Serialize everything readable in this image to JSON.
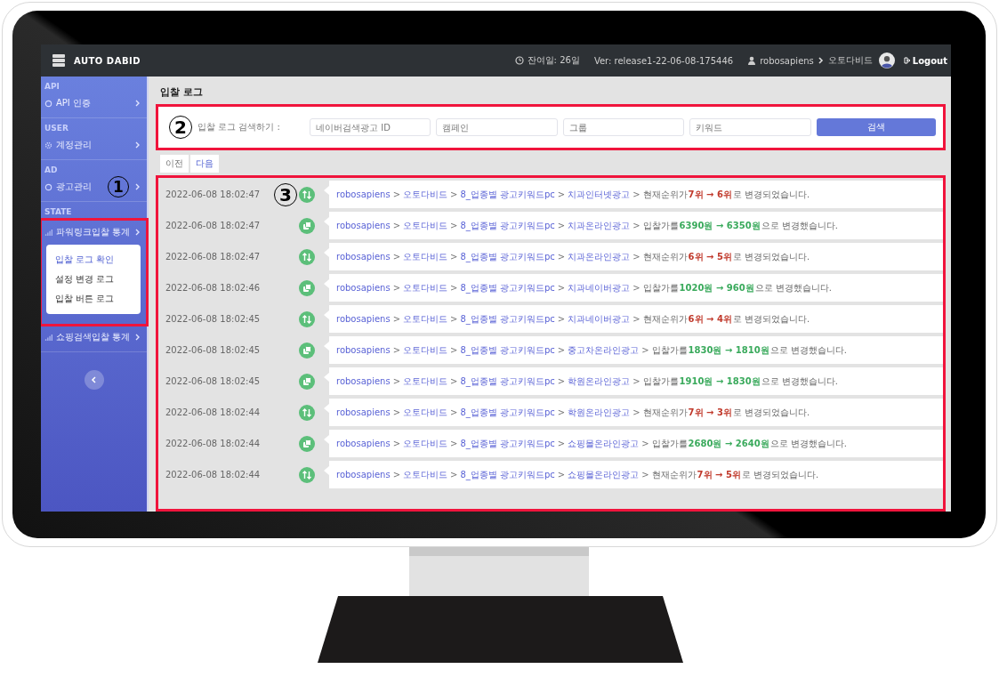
{
  "topbar": {
    "brand": "AUTO DABID",
    "remaining": "잔여일: 26일",
    "version": "Ver: release1-22-06-08-175446",
    "user": "robosapiens",
    "account": "오토다비드",
    "logout": "Logout"
  },
  "sidebar": {
    "sections": [
      {
        "heading": "API",
        "items": [
          {
            "label": "API 인증",
            "kind": "link",
            "expanded": false
          }
        ]
      },
      {
        "heading": "USER",
        "items": [
          {
            "label": "계정관리",
            "kind": "gear",
            "expanded": false
          }
        ]
      },
      {
        "heading": "AD",
        "items": [
          {
            "label": "광고관리",
            "kind": "link",
            "expanded": false
          }
        ]
      },
      {
        "heading": "STATE",
        "items": [
          {
            "label": "파워링크입찰 통계",
            "kind": "chart",
            "expanded": true,
            "children": [
              {
                "label": "입찰 로그 확인",
                "selected": true
              },
              {
                "label": "설정 변경 로그",
                "selected": false
              },
              {
                "label": "입찰 버튼 로그",
                "selected": false
              }
            ]
          },
          {
            "label": "쇼핑검색입찰 통계",
            "kind": "chart",
            "expanded": false
          }
        ]
      }
    ]
  },
  "page_title": "입찰 로그",
  "search": {
    "label": "입찰 로그 검색하기 :",
    "fields": [
      {
        "placeholder": "네이버검색광고 ID"
      },
      {
        "placeholder": "캠페인"
      },
      {
        "placeholder": "그룹"
      },
      {
        "placeholder": "키워드"
      }
    ],
    "button": "검색"
  },
  "pager": [
    {
      "label": "이전",
      "selected": false
    },
    {
      "label": "다음",
      "selected": true
    }
  ],
  "callouts": [
    "1",
    "2",
    "3"
  ],
  "logs": [
    {
      "time": "2022-06-08 18:02:47",
      "kind": "rank",
      "path": [
        "robosapiens",
        ">",
        "오토다비드",
        ">",
        "8_업종별 광고키워드pc",
        ">",
        "치과인터넷광고",
        ">"
      ],
      "lead": "현재순위가",
      "from": "7위",
      "arrow": "→",
      "to": "6위",
      "tail": "로 변경되었습니다."
    },
    {
      "time": "2022-06-08 18:02:47",
      "kind": "bid",
      "path": [
        "robosapiens",
        ">",
        "오토다비드",
        ">",
        "8_업종별 광고키워드pc",
        ">",
        "치과온라인광고",
        ">"
      ],
      "lead": "입찰가를",
      "from": "6390원",
      "arrow": "→",
      "to": "6350원",
      "tail": "으로 변경했습니다."
    },
    {
      "time": "2022-06-08 18:02:47",
      "kind": "rank",
      "path": [
        "robosapiens",
        ">",
        "오토다비드",
        ">",
        "8_업종별 광고키워드pc",
        ">",
        "치과온라인광고",
        ">"
      ],
      "lead": "현재순위가",
      "from": "6위",
      "arrow": "→",
      "to": "5위",
      "tail": "로 변경되었습니다."
    },
    {
      "time": "2022-06-08 18:02:46",
      "kind": "bid",
      "path": [
        "robosapiens",
        ">",
        "오토다비드",
        ">",
        "8_업종별 광고키워드pc",
        ">",
        "치과네이버광고",
        ">"
      ],
      "lead": "입찰가를",
      "from": "1020원",
      "arrow": "→",
      "to": "960원",
      "tail": "으로 변경했습니다."
    },
    {
      "time": "2022-06-08 18:02:45",
      "kind": "rank",
      "path": [
        "robosapiens",
        ">",
        "오토다비드",
        ">",
        "8_업종별 광고키워드pc",
        ">",
        "치과네이버광고",
        ">"
      ],
      "lead": "현재순위가",
      "from": "6위",
      "arrow": "→",
      "to": "4위",
      "tail": "로 변경되었습니다."
    },
    {
      "time": "2022-06-08 18:02:45",
      "kind": "bid",
      "path": [
        "robosapiens",
        ">",
        "오토다비드",
        ">",
        "8_업종별 광고키워드pc",
        ">",
        "중고차온라인광고",
        ">"
      ],
      "lead": "입찰가를",
      "from": "1830원",
      "arrow": "→",
      "to": "1810원",
      "tail": "으로 변경했습니다."
    },
    {
      "time": "2022-06-08 18:02:45",
      "kind": "bid",
      "path": [
        "robosapiens",
        ">",
        "오토다비드",
        ">",
        "8_업종별 광고키워드pc",
        ">",
        "학원온라인광고",
        ">"
      ],
      "lead": "입찰가를",
      "from": "1910원",
      "arrow": "→",
      "to": "1830원",
      "tail": "으로 변경했습니다."
    },
    {
      "time": "2022-06-08 18:02:44",
      "kind": "rank",
      "path": [
        "robosapiens",
        ">",
        "오토다비드",
        ">",
        "8_업종별 광고키워드pc",
        ">",
        "학원온라인광고",
        ">"
      ],
      "lead": "현재순위가",
      "from": "7위",
      "arrow": "→",
      "to": "3위",
      "tail": "로 변경되었습니다."
    },
    {
      "time": "2022-06-08 18:02:44",
      "kind": "bid",
      "path": [
        "robosapiens",
        ">",
        "오토다비드",
        ">",
        "8_업종별 광고키워드pc",
        ">",
        "쇼핑몰온라인광고",
        ">"
      ],
      "lead": "입찰가를",
      "from": "2680원",
      "arrow": "→",
      "to": "2640원",
      "tail": "으로 변경했습니다."
    },
    {
      "time": "2022-06-08 18:02:44",
      "kind": "rank",
      "path": [
        "robosapiens",
        ">",
        "오토다비드",
        ">",
        "8_업종별 광고키워드pc",
        ">",
        "쇼핑몰온라인광고",
        ">"
      ],
      "lead": "현재순위가",
      "from": "7위",
      "arrow": "→",
      "to": "5위",
      "tail": "로 변경되었습니다."
    }
  ]
}
